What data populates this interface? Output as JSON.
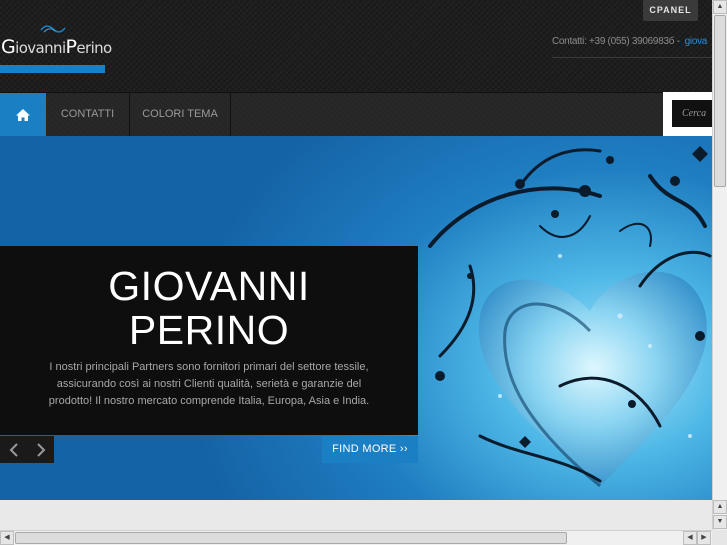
{
  "header": {
    "logo": {
      "cap1": "G",
      "part1": "iovanni",
      "cap2": "P",
      "part2": "erino"
    },
    "cpanel_label": "CPANEL",
    "contact_text": "Contatti: +39 (055) 3906983б -",
    "contact_mail": "giova"
  },
  "nav": {
    "home_icon": "home-icon",
    "items": [
      {
        "label": "CONTATTI"
      },
      {
        "label": "COLORI TEMA"
      }
    ],
    "search_placeholder": "Cerca"
  },
  "slider": {
    "title_line1": "GIOVANNI",
    "title_line2": "PERINO",
    "description": "I nostri principali Partners sono fornitori primari del settore tessile, assicurando così ai nostri Clienti qualità, serietà e garanzie del prodotto! Il nostro mercato comprende Italia, Europa, Asia e India.",
    "prev_icon": "chevron-left-icon",
    "next_icon": "chevron-right-icon",
    "cta_label": "FIND MORE ››"
  },
  "colors": {
    "accent": "#1b7fc4",
    "header_bg": "#1e1e1e",
    "caption_bg": "#0e0e0e"
  }
}
